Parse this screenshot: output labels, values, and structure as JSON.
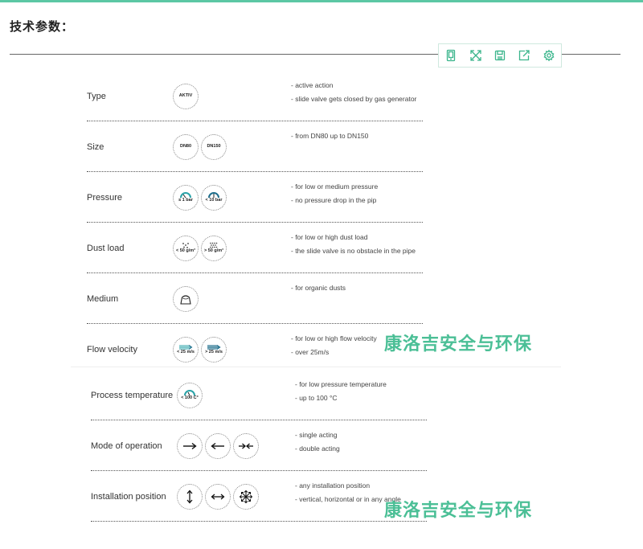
{
  "page": {
    "heading": "技术参数：",
    "accent_color": "#5cc7a4"
  },
  "toolbar": {
    "buttons": [
      {
        "name": "tablet-icon"
      },
      {
        "name": "fullscreen-icon"
      },
      {
        "name": "save-icon"
      },
      {
        "name": "share-icon"
      },
      {
        "name": "settings-icon"
      }
    ]
  },
  "params": {
    "type": {
      "label": "Type",
      "badges": [
        "AKTIV"
      ],
      "lines": [
        "- active action",
        "- slide valve gets closed by gas generator"
      ]
    },
    "size": {
      "label": "Size",
      "badges": [
        "DN80",
        "DN150"
      ],
      "lines": [
        "- from DN80 up to DN150"
      ]
    },
    "pressure": {
      "label": "Pressure",
      "badges": [
        "≤ 1 bar",
        "< 10 bar"
      ],
      "lines": [
        "- for low or medium pressure",
        "- no pressure drop in the pip"
      ]
    },
    "dust_load": {
      "label": "Dust load",
      "badges": [
        "< 50 g/m³",
        "> 50 g/m³"
      ],
      "lines": [
        "- for low or high dust load",
        "- the slide valve is no obstacle in the pipe"
      ]
    },
    "medium": {
      "label": "Medium",
      "badges": [],
      "lines": [
        "- for organic dusts"
      ]
    },
    "flow_velocity": {
      "label": "Flow velocity",
      "badges": [
        "< 25 m/s",
        "> 25 m/s"
      ],
      "lines": [
        "- for low or high flow velocity",
        "- over 25m/s"
      ]
    },
    "process_temperature": {
      "label": "Process temperature",
      "badges": [
        "< 100 C°"
      ],
      "lines": [
        "- for low pressure temperature",
        "- up to 100 °C"
      ]
    },
    "mode_of_operation": {
      "label": "Mode of operation",
      "badges": [],
      "lines": [
        "- single acting",
        "- double acting"
      ]
    },
    "installation_position": {
      "label": "Installation position",
      "badges": [],
      "lines": [
        "- any installation position",
        "- vertical, horizontal or in any angle"
      ]
    }
  },
  "watermarks": [
    "康洛吉安全与环保",
    "康洛吉安全与环保"
  ]
}
